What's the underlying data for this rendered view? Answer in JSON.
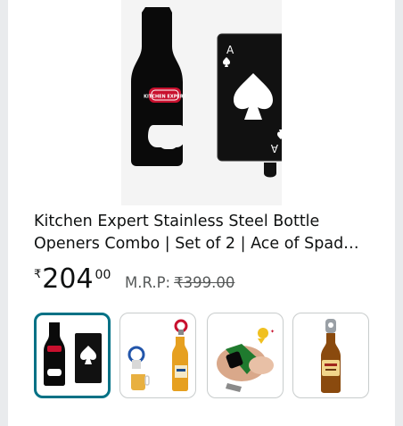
{
  "product": {
    "title": "Kitchen Expert Stainless Steel Bottle Openers Combo | Set of 2 | Ace of Spad…",
    "price": {
      "currency_symbol": "₹",
      "whole": "204",
      "fraction": "00"
    },
    "mrp": {
      "label": "M.R.P:",
      "value": "₹399.00"
    },
    "hero_logo_text": "KITCHEN EXPERT",
    "card_rank": "A"
  },
  "thumbnails": [
    {
      "name": "combo-black-openers",
      "selected": true
    },
    {
      "name": "bottle-opener-with-beer",
      "selected": false
    },
    {
      "name": "opener-in-use",
      "selected": false
    },
    {
      "name": "bottle-shaped-opener",
      "selected": false
    }
  ],
  "colors": {
    "selected_border": "#007185",
    "text": "#0f1111",
    "muted": "#565959",
    "logo_red": "#c8102e"
  }
}
